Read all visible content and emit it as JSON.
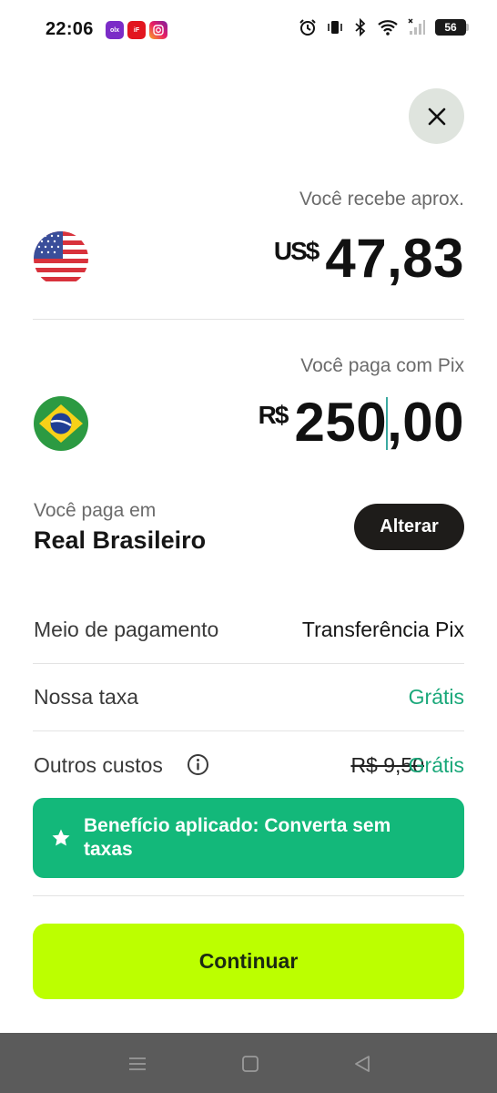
{
  "status_bar": {
    "time": "22:06",
    "notifications": [
      "olx",
      "iFood",
      "Instagram"
    ],
    "battery": "56"
  },
  "receive": {
    "caption": "Você recebe aprox.",
    "currency_symbol": "US$",
    "amount": "47,83",
    "flag": "us-flag-icon"
  },
  "pay": {
    "caption": "Você paga com Pix",
    "currency_symbol": "R$",
    "amount_before_caret": "250",
    "amount_after_caret": ",00",
    "flag": "brazil-flag-icon"
  },
  "pay_in": {
    "caption": "Você paga em",
    "currency": "Real Brasileiro",
    "change_label": "Alterar"
  },
  "details": {
    "method_label": "Meio de pagamento",
    "method_value": "Transferência Pix",
    "fee_label": "Nossa taxa",
    "fee_value": "Grátis",
    "other_label": "Outros custos",
    "other_old_value": "R$ 9,50",
    "other_value": "Grátis"
  },
  "benefit": {
    "text": "Benefício aplicado: Converta sem taxas"
  },
  "continue_label": "Continuar",
  "colors": {
    "accent_green": "#13b87a",
    "free_text": "#1aa87a",
    "cta_lime": "#bcff00",
    "dark_button": "#1e1c1a",
    "close_bg": "#dfe4de"
  }
}
